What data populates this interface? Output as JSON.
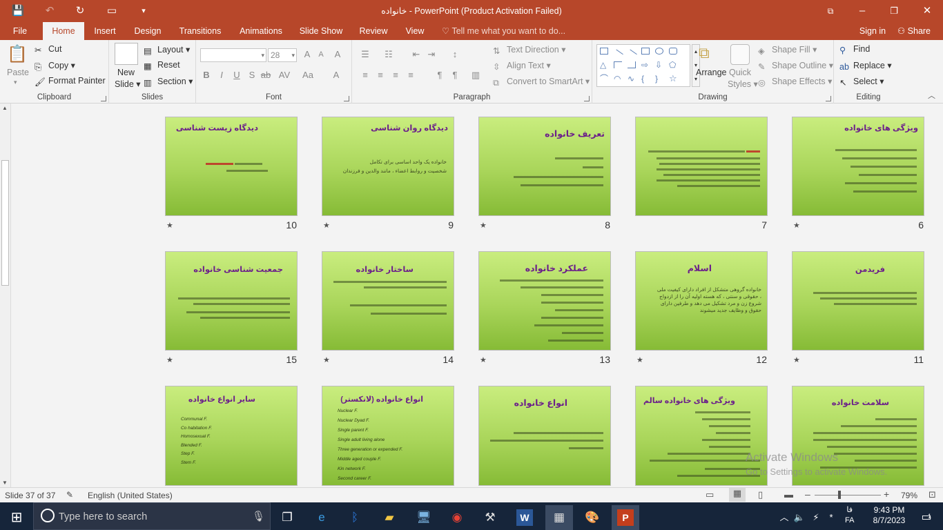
{
  "window": {
    "title": "خانواده - PowerPoint (Product Activation Failed)"
  },
  "qat": {
    "save": "save-icon",
    "undo": "undo-icon",
    "redo": "redo-icon",
    "present": "present-icon",
    "customize": "customize-icon"
  },
  "tabs": [
    "File",
    "Home",
    "Insert",
    "Design",
    "Transitions",
    "Animations",
    "Slide Show",
    "Review",
    "View"
  ],
  "tell_me": "Tell me what you want to do...",
  "sign_in": "Sign in",
  "share": "Share",
  "ribbon": {
    "clipboard": {
      "paste": "Paste",
      "cut": "Cut",
      "copy": "Copy",
      "format_painter": "Format Painter",
      "label": "Clipboard"
    },
    "slides": {
      "new_slide": "New",
      "new_slide2": "Slide",
      "layout": "Layout",
      "reset": "Reset",
      "section": "Section",
      "label": "Slides"
    },
    "font": {
      "font_name": "",
      "font_size": "28",
      "label": "Font"
    },
    "paragraph": {
      "text_direction": "Text Direction",
      "align_text": "Align Text",
      "convert_smartart": "Convert to SmartArt",
      "label": "Paragraph"
    },
    "drawing": {
      "arrange": "Arrange",
      "quick_styles": "Quick",
      "quick_styles2": "Styles",
      "shape_fill": "Shape Fill",
      "shape_outline": "Shape Outline",
      "shape_effects": "Shape Effects",
      "label": "Drawing"
    },
    "editing": {
      "find": "Find",
      "replace": "Replace",
      "select": "Select",
      "label": "Editing"
    }
  },
  "slides": [
    {
      "num": "6",
      "title": "ویژگی های خانواده"
    },
    {
      "num": "7",
      "title": ""
    },
    {
      "num": "8",
      "title": "تعریف خانواده"
    },
    {
      "num": "9",
      "title": "دیدگاه روان شناسی",
      "body": [
        "خانواده یک واحد اساسی برای تکامل",
        "شخصیت و روابط اعضاء ، مانند والدین و فرزندان"
      ]
    },
    {
      "num": "10",
      "title": "دیدگاه زیست شناسی"
    },
    {
      "num": "11",
      "title": "فریدمن"
    },
    {
      "num": "12",
      "title": "اسلام",
      "body": [
        "خانواده گروهی متشکل از افراد دارای کیفیت ملی",
        "، حقوقی و سنتی ، که هسته اولیه آن را از ازدواج",
        "شروع زن و مرد تشکیل می دهد و طرفین دارای",
        "حقوق و وظایف جدید میشوند"
      ]
    },
    {
      "num": "13",
      "title": "عملکرد خانواده"
    },
    {
      "num": "14",
      "title": "ساختار خانواده"
    },
    {
      "num": "15",
      "title": "جمعیت شناسی خانواده"
    },
    {
      "num": "",
      "title": "سلامت خانواده"
    },
    {
      "num": "",
      "title": "ویژگی های خانواده سالم"
    },
    {
      "num": "",
      "title": "انواع خانواده"
    },
    {
      "num": "",
      "title": "انواع خانواده (لانکستر)",
      "list": [
        "Nuclear F.",
        "Nuclear Dyad F.",
        "Single parent F.",
        "Single adult living alone",
        "Three generation or expended F.",
        "Middle aged couple F.",
        "Kin network F.",
        "Second career F."
      ]
    },
    {
      "num": "",
      "title": "سایر انواع خانواده",
      "list": [
        "Communal F.",
        "Co habitation F.",
        "Homosexual F.",
        "Blended F.",
        "Step F.",
        "Stem F."
      ]
    }
  ],
  "status": {
    "slide": "Slide 37 of 37",
    "language": "English (United States)",
    "zoom": "79%"
  },
  "watermark": {
    "line1": "Activate Windows",
    "line2": "Go to Settings to activate Windows."
  },
  "taskbar": {
    "search": "Type here to search",
    "time": "9:43 PM",
    "date": "8/7/2023",
    "lang1": "فا",
    "lang2": "FA",
    "notifications": "1"
  }
}
